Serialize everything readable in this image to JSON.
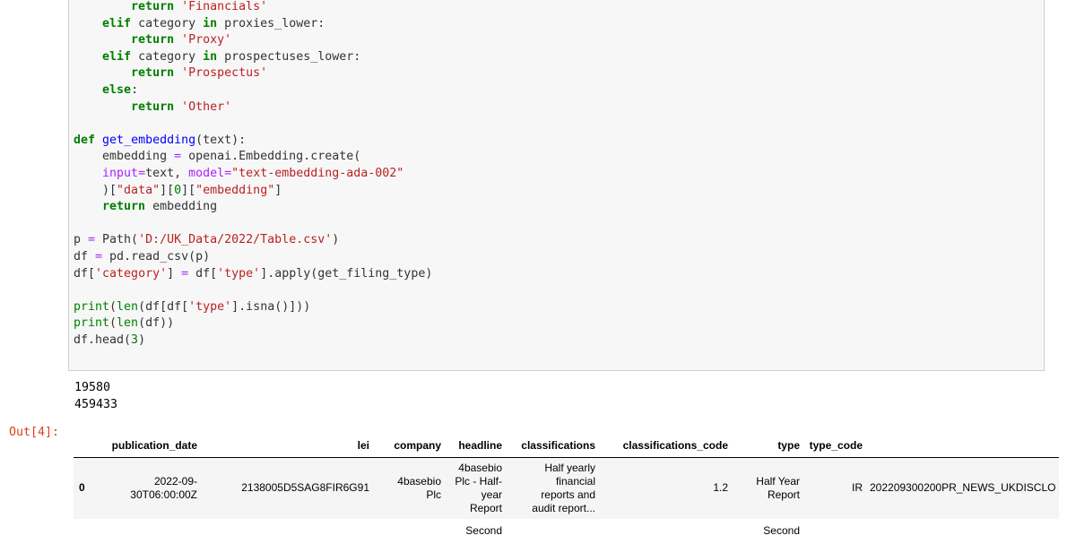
{
  "code_lines": [
    "        return 'Financials'",
    "    elif category in proxies_lower:",
    "        return 'Proxy'",
    "    elif category in prospectuses_lower:",
    "        return 'Prospectus'",
    "    else:",
    "        return 'Other'",
    "",
    "def get_embedding(text):",
    "    embedding = openai.Embedding.create(",
    "    input=text, model=\"text-embedding-ada-002\"",
    "    )[\"data\"][0][\"embedding\"]",
    "    return embedding",
    "",
    "p = Path('D:/UK_Data/2022/Table.csv')",
    "df = pd.read_csv(p)",
    "df['category'] = df['type'].apply(get_filing_type)",
    "",
    "print(len(df[df['type'].isna()]))",
    "print(len(df))",
    "df.head(3)"
  ],
  "output": {
    "prompt": "Out[4]:",
    "stdout": [
      "19580",
      "459433"
    ],
    "table": {
      "columns": [
        "",
        "publication_date",
        "lei",
        "company",
        "headline",
        "classifications",
        "classifications_code",
        "type",
        "type_code",
        ""
      ],
      "rows": [
        [
          "0",
          "2022-09-\n30T06:00:00Z",
          "2138005D5SAG8FIR6G91",
          "4basebio\nPlc",
          "4basebio\nPlc - Half-\nyear\nReport",
          "Half yearly\nfinancial\nreports and\naudit report...",
          "1.2",
          "Half Year\nReport",
          "IR",
          "202209300200PR_NEWS_UKDISCLO"
        ],
        [
          "",
          "",
          "",
          "",
          "Second",
          "",
          "",
          "Second",
          "",
          ""
        ]
      ]
    }
  }
}
